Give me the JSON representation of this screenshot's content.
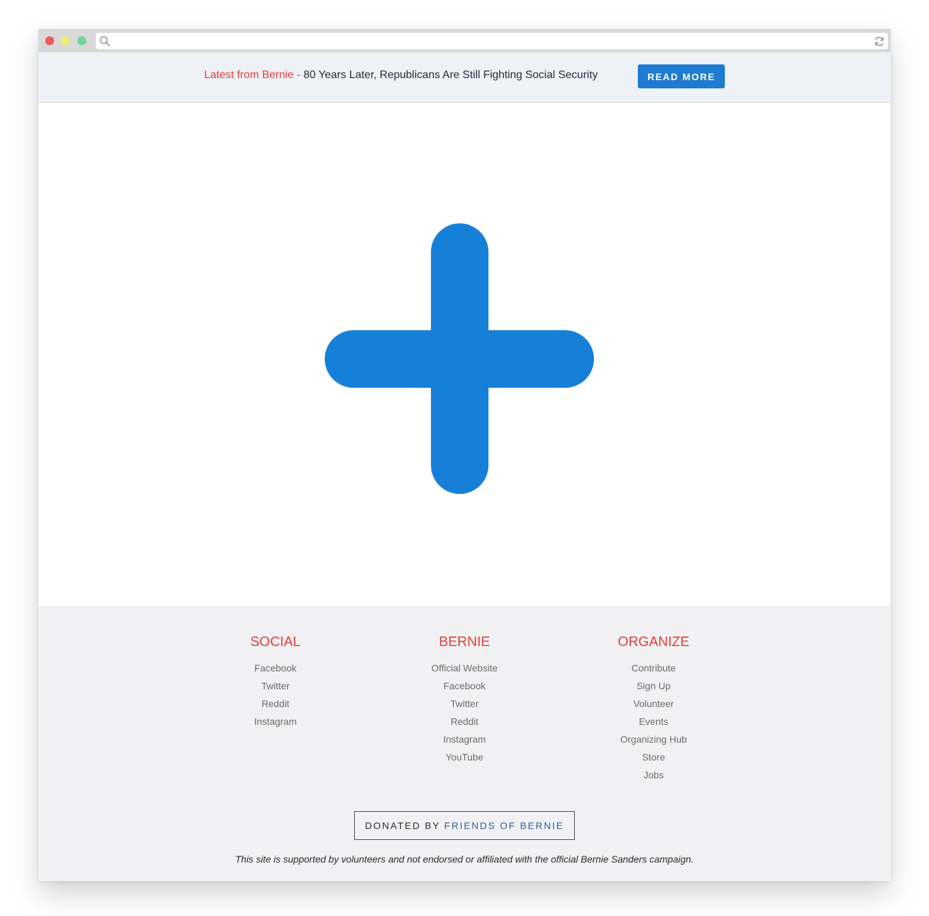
{
  "colors": {
    "accent_red": "#e33d3d",
    "brand_blue": "#1e7bd1",
    "plus_blue": "#1680d8",
    "traffic_red": "#ee5b5f",
    "traffic_yellow": "#ecec6e",
    "traffic_green": "#6bd69a"
  },
  "browser": {
    "url": "",
    "icons": {
      "search": "search-icon",
      "reload": "reload-icon"
    }
  },
  "announcement": {
    "prefix": "Latest from Bernie - ",
    "headline": "80 Years Later, Republicans Are Still Fighting Social Security",
    "button_label": "READ MORE"
  },
  "hero": {
    "icon": "plus-icon"
  },
  "footer": {
    "columns": [
      {
        "title": "SOCIAL",
        "links": [
          "Facebook",
          "Twitter",
          "Reddit",
          "Instagram"
        ]
      },
      {
        "title": "BERNIE",
        "links": [
          "Official Website",
          "Facebook",
          "Twitter",
          "Reddit",
          "Instagram",
          "YouTube"
        ]
      },
      {
        "title": "ORGANIZE",
        "links": [
          "Contribute",
          "Sign Up",
          "Volunteer",
          "Events",
          "Organizing Hub",
          "Store",
          "Jobs"
        ]
      }
    ],
    "donated_prefix": "DONATED BY ",
    "donated_link": "FRIENDS OF BERNIE",
    "disclaimer": "This site is supported by volunteers and not endorsed or affiliated with the official Bernie Sanders campaign."
  }
}
